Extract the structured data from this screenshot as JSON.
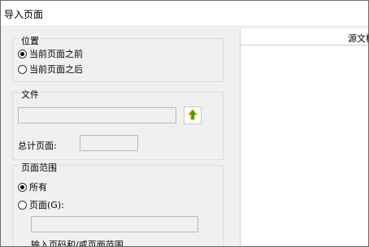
{
  "window": {
    "title": "导入页面"
  },
  "position_group": {
    "title": "位置",
    "options": [
      {
        "label": "当前页面之前",
        "checked": true
      },
      {
        "label": "当前页面之后",
        "checked": false
      }
    ]
  },
  "file_group": {
    "title": "文件",
    "path_value": "",
    "total_pages_label": "总计页面:",
    "total_pages_value": "",
    "browse_icon": "up-arrow-icon"
  },
  "range_group": {
    "title": "页面范围",
    "options": [
      {
        "label": "所有",
        "checked": true
      },
      {
        "label": "页面(G):",
        "checked": false
      }
    ],
    "pages_value": "",
    "hint": "输入页码和/或页面范围"
  },
  "preview": {
    "header": "源文档"
  }
}
